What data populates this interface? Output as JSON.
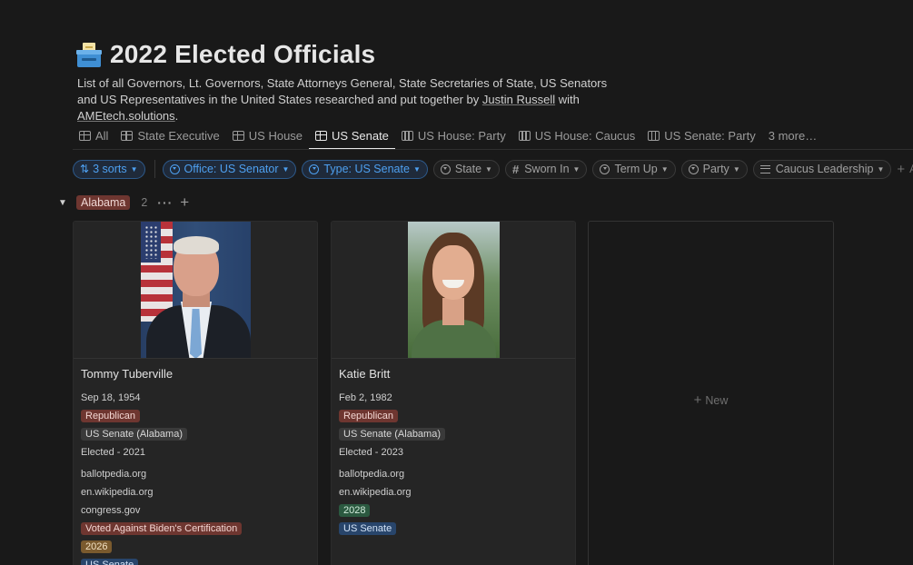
{
  "page": {
    "title": "2022 Elected Officials",
    "icon": "ballot-box-icon",
    "description_lead": "List of all Governors, Lt. Governors, State Attorneys General, State Secretaries of State, US Senators and US Representatives in the United States researched and put together by",
    "description_link1": "Justin Russell",
    "description_mid": "with",
    "description_link2": "AMEtech.solutions",
    "description_end": "."
  },
  "tabs": [
    {
      "label": "All",
      "icon": "gallery-icon"
    },
    {
      "label": "State Executive",
      "icon": "gallery-icon"
    },
    {
      "label": "US House",
      "icon": "gallery-icon"
    },
    {
      "label": "US Senate",
      "icon": "gallery-icon",
      "active": true
    },
    {
      "label": "US House: Party",
      "icon": "board-icon"
    },
    {
      "label": "US House: Caucus",
      "icon": "board-icon"
    },
    {
      "label": "US Senate: Party",
      "icon": "board-icon"
    },
    {
      "label": "3 more…"
    }
  ],
  "filters": {
    "sorts": "3 sorts",
    "office": "Office: US Senator",
    "type": "Type: US Senate",
    "state": "State",
    "sworn_in": "Sworn In",
    "term_up": "Term Up",
    "party": "Party",
    "caucus": "Caucus Leadership",
    "add": "Ad"
  },
  "colors": {
    "background": "#191919",
    "accent": "#4ea0f0",
    "republican": "#6e3630"
  },
  "group": {
    "label": "Alabama",
    "count": "2"
  },
  "cards": [
    {
      "name": "Tommy Tuberville",
      "birthdate": "Sep 18, 1954",
      "party": "Republican",
      "seat": "US Senate (Alabama)",
      "elected": "Elected - 2021",
      "links": [
        "ballotpedia.org",
        "en.wikipedia.org",
        "congress.gov"
      ],
      "note": "Voted Against Biden's Certification",
      "term_up": "2026",
      "type": "US Senate"
    },
    {
      "name": "Katie Britt",
      "birthdate": "Feb 2, 1982",
      "party": "Republican",
      "seat": "US Senate (Alabama)",
      "elected": "Elected - 2023",
      "links": [
        "ballotpedia.org",
        "en.wikipedia.org"
      ],
      "term_up": "2028",
      "type": "US Senate"
    }
  ],
  "new_card": {
    "label": "New"
  }
}
